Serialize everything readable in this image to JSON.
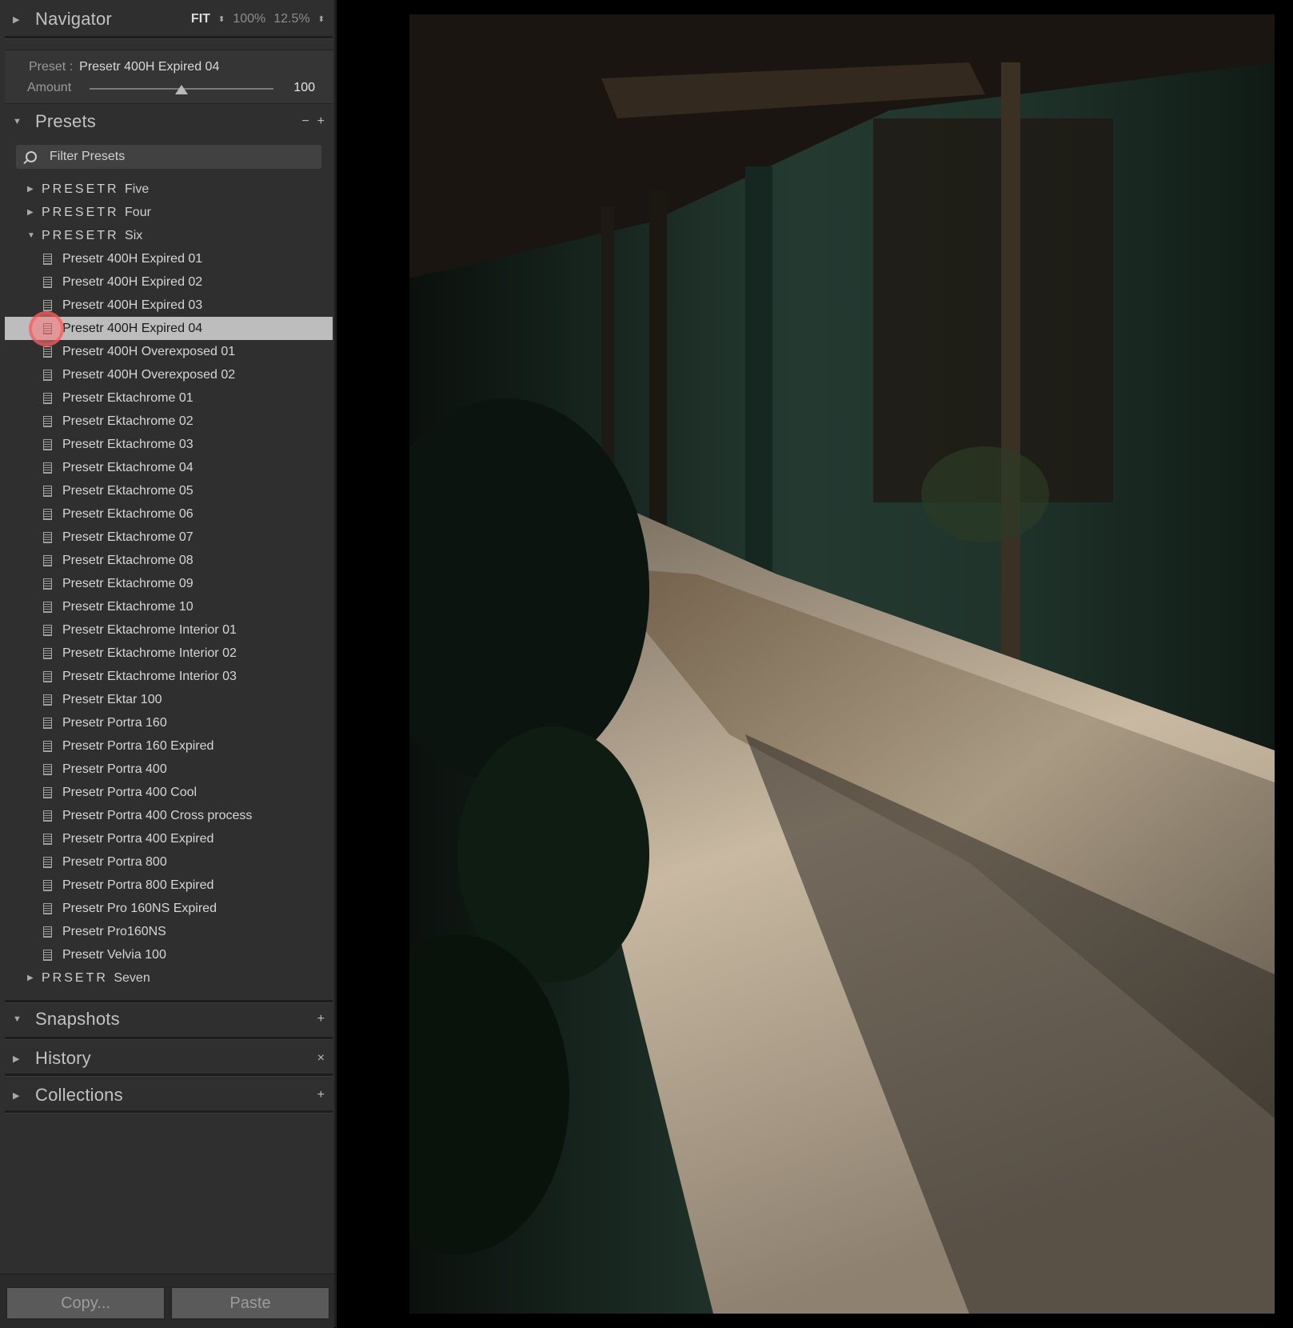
{
  "navigator": {
    "title": "Navigator",
    "zoom_fit": "FIT",
    "zoom_100": "100%",
    "zoom_125": "12.5%"
  },
  "preset_info": {
    "preset_label": "Preset :",
    "preset_value": "Presetr 400H Expired 04",
    "amount_label": "Amount",
    "amount_value": "100",
    "amount_fraction": 0.5
  },
  "presets_panel": {
    "title": "Presets",
    "minus": "−",
    "plus": "+",
    "filter_placeholder": "Filter Presets",
    "folders_top": [
      {
        "name": "PRESETR",
        "tail": "Five",
        "expanded": false
      },
      {
        "name": "PRESETR",
        "tail": "Four",
        "expanded": false
      },
      {
        "name": "PRESETR",
        "tail": "Six",
        "expanded": true
      }
    ],
    "items": [
      "Presetr 400H Expired 01",
      "Presetr 400H Expired 02",
      "Presetr 400H Expired 03",
      "Presetr 400H Expired 04",
      "Presetr 400H Overexposed 01",
      "Presetr 400H Overexposed 02",
      "Presetr Ektachrome 01",
      "Presetr Ektachrome 02",
      "Presetr Ektachrome 03",
      "Presetr Ektachrome 04",
      "Presetr Ektachrome 05",
      "Presetr Ektachrome 06",
      "Presetr Ektachrome 07",
      "Presetr Ektachrome 08",
      "Presetr Ektachrome 09",
      "Presetr Ektachrome 10",
      "Presetr Ektachrome Interior 01",
      "Presetr Ektachrome Interior 02",
      "Presetr Ektachrome Interior 03",
      "Presetr Ektar 100",
      "Presetr Portra 160",
      "Presetr Portra 160 Expired",
      "Presetr Portra 400",
      "Presetr Portra 400 Cool",
      "Presetr Portra 400 Cross process",
      "Presetr Portra 400 Expired",
      "Presetr Portra 800",
      "Presetr Portra 800 Expired",
      "Presetr Pro 160NS Expired",
      "Presetr Pro160NS",
      "Presetr Velvia 100"
    ],
    "selected_index": 3,
    "folder_bottom": {
      "name": "PRSETR",
      "tail": "Seven",
      "expanded": false
    }
  },
  "snapshots": {
    "title": "Snapshots",
    "action": "+"
  },
  "history": {
    "title": "History",
    "action": "×"
  },
  "collections": {
    "title": "Collections",
    "action": "+"
  },
  "buttons": {
    "copy": "Copy...",
    "paste": "Paste"
  },
  "colors": {
    "panel_bg": "#2f2f2f",
    "selected_row": "#bdbdbd",
    "canvas_bg": "#000000"
  }
}
